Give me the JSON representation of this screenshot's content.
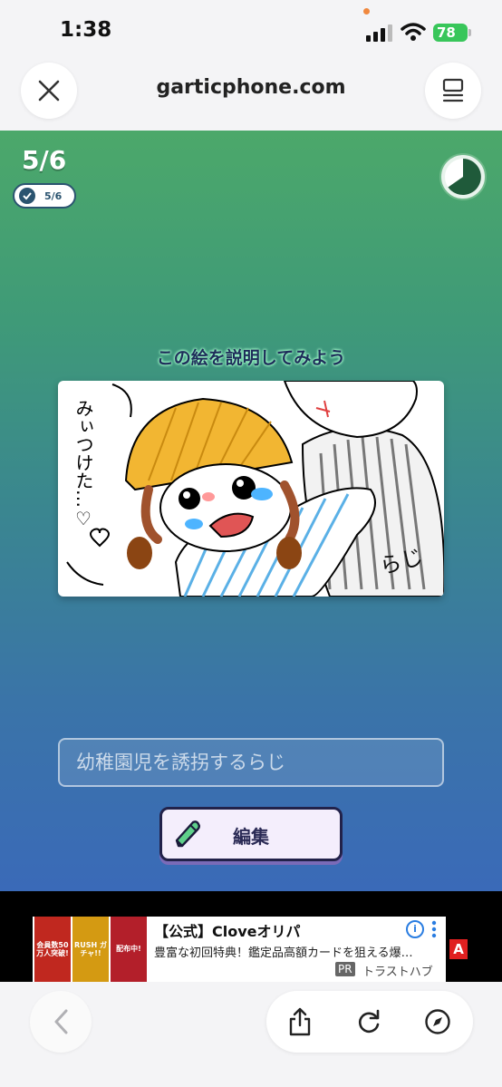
{
  "status_bar": {
    "time": "1:38",
    "battery": "78"
  },
  "browser": {
    "url": "garticphone.com"
  },
  "game": {
    "round_large": "5/6",
    "round_small": "5/6",
    "prompt_title": "この絵を説明してみよう",
    "drawing_texts": {
      "left_caption": "みぃつけた…♡",
      "right_caption": "らじ"
    },
    "answer_value": "幼稚園児を誘拐するらじ",
    "edit_button_label": "編集"
  },
  "ad": {
    "thumb_1": "会員数50万人突破!",
    "thumb_2": "RUSH ガチャ!!",
    "thumb_3": "配布中!",
    "title": "【公式】Cloveオリパ",
    "subtitle": "豊富な初回特典！鑑定品高額カードを狙える爆…",
    "pr_label": "PR",
    "brand": "トラストハブ",
    "badge": "A"
  },
  "colors": {
    "game_gradient_top": "#4ca86a",
    "game_gradient_bottom": "#3a6ab8",
    "prompt_glow": "#a6ffcc",
    "button_border": "#22224a",
    "battery_green": "#38c65a"
  }
}
